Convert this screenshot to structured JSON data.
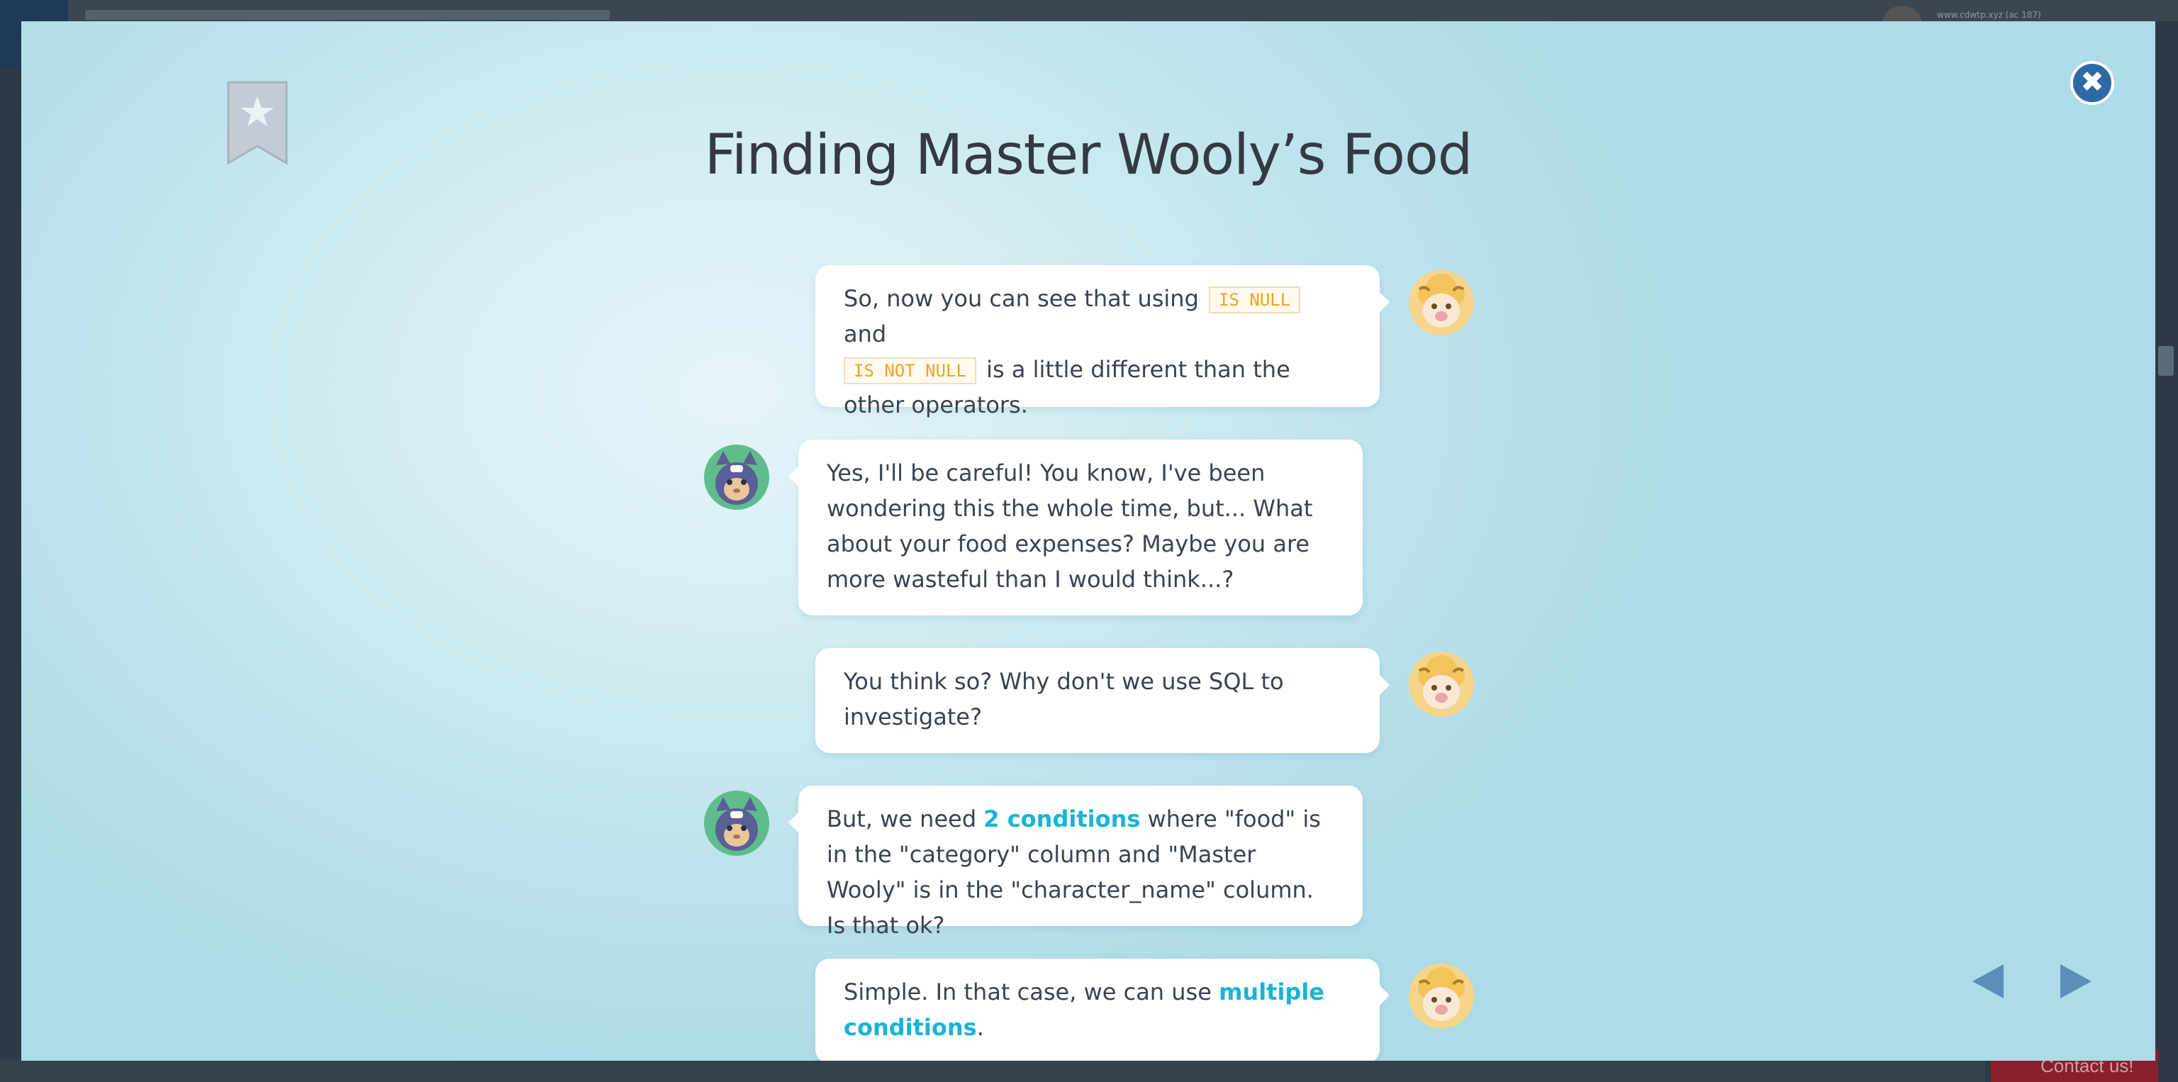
{
  "background": {
    "user_text": "www.cdwtp.xyz (ac 187)",
    "contact_label": "Contact us!"
  },
  "modal": {
    "title": "Finding Master Wooly’s Food",
    "close_symbol": "✖"
  },
  "chat": {
    "messages": [
      {
        "speaker": "sheep",
        "seg1": "So, now you can see that using ",
        "code1": "IS NULL",
        "seg2": " and ",
        "code2": "IS NOT NULL",
        "seg3": " is a little different than the other operators."
      },
      {
        "speaker": "cat",
        "text": "Yes, I'll be careful! You know, I've been wondering this the whole time, but... What about your food expenses? Maybe you are more wasteful than I would think...?"
      },
      {
        "speaker": "sheep",
        "text": "You think so? Why don't we use SQL to investigate?"
      },
      {
        "speaker": "cat",
        "seg1": "But, we need ",
        "highlight": "2 conditions",
        "seg2": " where \"food\" is in the \"category\" column and \"Master Wooly\" is in the \"character_name\" column. Is that ok?"
      },
      {
        "speaker": "sheep",
        "seg1": "Simple. In that case, we can use ",
        "highlight": "multiple conditions",
        "seg2": "."
      }
    ]
  },
  "colors": {
    "accent": "#1ab3d6",
    "code_text": "#f0a41c",
    "close_button": "#2d6aa5",
    "nav_arrow": "#5b8fb5"
  },
  "icons": {
    "bookmark": "bookmark-star-icon",
    "close": "close-icon",
    "prev": "arrow-left-icon",
    "next": "arrow-right-icon",
    "sheep": "sheep-avatar-icon",
    "cat": "cat-avatar-icon"
  }
}
